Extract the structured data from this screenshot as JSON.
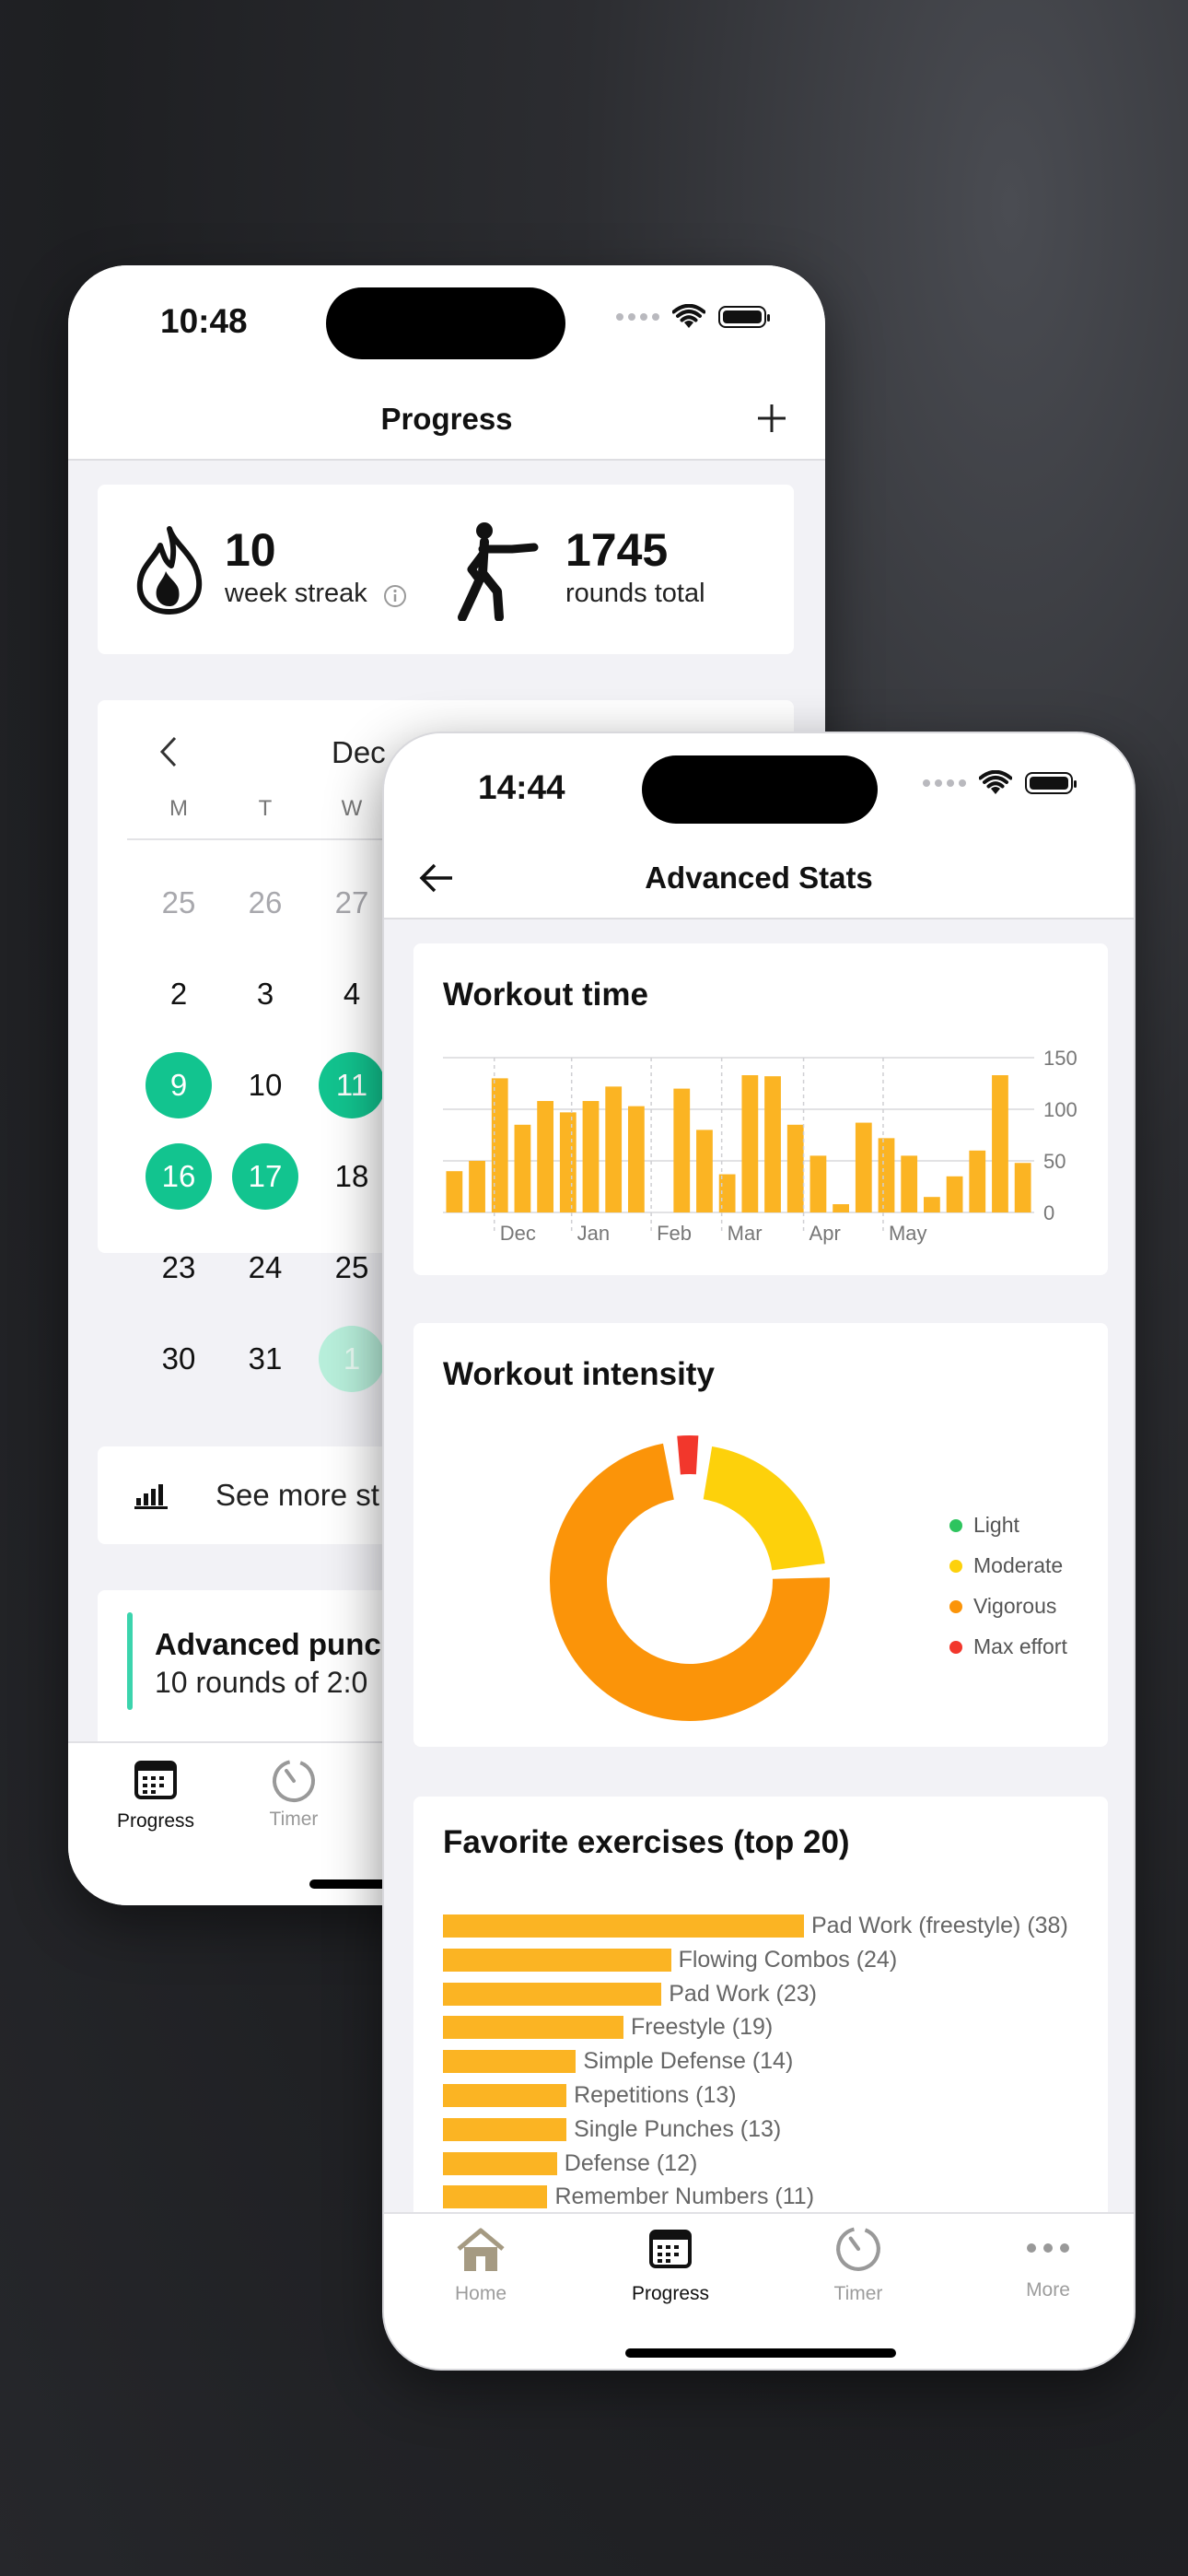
{
  "phone1": {
    "status_time": "10:48",
    "title": "Progress",
    "add_label": "+",
    "streak": {
      "value": "10",
      "label": "week streak",
      "info_icon": "info-icon"
    },
    "rounds": {
      "value": "1745",
      "label": "rounds total"
    },
    "calendar": {
      "month_label": "Dec",
      "weekdays": [
        "M",
        "T",
        "W"
      ],
      "rows": [
        [
          {
            "d": "25",
            "s": "muted"
          },
          {
            "d": "26",
            "s": "muted"
          },
          {
            "d": "27",
            "s": "muted"
          }
        ],
        [
          {
            "d": "2",
            "s": ""
          },
          {
            "d": "3",
            "s": ""
          },
          {
            "d": "4",
            "s": ""
          }
        ],
        [
          {
            "d": "9",
            "s": "active"
          },
          {
            "d": "10",
            "s": ""
          },
          {
            "d": "11",
            "s": "active"
          }
        ],
        [
          {
            "d": "16",
            "s": "active"
          },
          {
            "d": "17",
            "s": "active"
          },
          {
            "d": "18",
            "s": ""
          }
        ],
        [
          {
            "d": "23",
            "s": ""
          },
          {
            "d": "24",
            "s": ""
          },
          {
            "d": "25",
            "s": ""
          }
        ],
        [
          {
            "d": "30",
            "s": ""
          },
          {
            "d": "31",
            "s": ""
          },
          {
            "d": "1",
            "s": "faded"
          }
        ]
      ]
    },
    "see_more": "See more st",
    "workout": {
      "title": "Advanced punc",
      "subtitle": "10 rounds of 2:0"
    },
    "tabs": [
      {
        "label": "Progress",
        "icon": "calendar-icon"
      },
      {
        "label": "Timer",
        "icon": "timer-icon"
      }
    ]
  },
  "phone2": {
    "status_time": "14:44",
    "title": "Advanced Stats",
    "workout_time": {
      "title": "Workout time",
      "chart_data": {
        "type": "bar",
        "title": "Workout time",
        "ylim": [
          0,
          150
        ],
        "yticks": [
          "150",
          "100",
          "50",
          "0"
        ],
        "xlabels": [
          "Dec",
          "Jan",
          "Feb",
          "Mar",
          "Apr",
          "May"
        ],
        "values": [
          40,
          50,
          130,
          85,
          108,
          97,
          108,
          122,
          103,
          0,
          120,
          80,
          37,
          133,
          132,
          85,
          55,
          8,
          87,
          72,
          55,
          15,
          35,
          60,
          133,
          48
        ],
        "grid": true
      }
    },
    "workout_intensity": {
      "title": "Workout intensity",
      "chart_data": {
        "type": "pie",
        "labels": [
          "Light",
          "Moderate",
          "Vigorous",
          "Max effort"
        ],
        "values": [
          0,
          22,
          74,
          4
        ],
        "colors": [
          "#2ec45e",
          "#fdd10b",
          "#fb9409",
          "#f2372c"
        ]
      },
      "legend": [
        {
          "label": "Light",
          "color": "#2ec45e"
        },
        {
          "label": "Moderate",
          "color": "#fdd10b"
        },
        {
          "label": "Vigorous",
          "color": "#fb9409"
        },
        {
          "label": "Max effort",
          "color": "#f2372c"
        }
      ]
    },
    "favorites": {
      "title": "Favorite exercises (top 20)",
      "chart_data": {
        "type": "bar",
        "orientation": "horizontal",
        "categories": [
          "Pad Work (freestyle) (38)",
          "Flowing Combos (24)",
          "Pad Work (23)",
          "Freestyle (19)",
          "Simple Defense (14)",
          "Repetitions (13)",
          "Single Punches (13)",
          "Defense (12)",
          "Remember Numbers (11)"
        ],
        "values": [
          38,
          24,
          23,
          19,
          14,
          13,
          13,
          12,
          11
        ]
      }
    },
    "tabs": [
      {
        "label": "Home",
        "icon": "home-icon"
      },
      {
        "label": "Progress",
        "icon": "calendar-icon"
      },
      {
        "label": "Timer",
        "icon": "timer-icon"
      },
      {
        "label": "More",
        "icon": "more-icon"
      }
    ]
  }
}
